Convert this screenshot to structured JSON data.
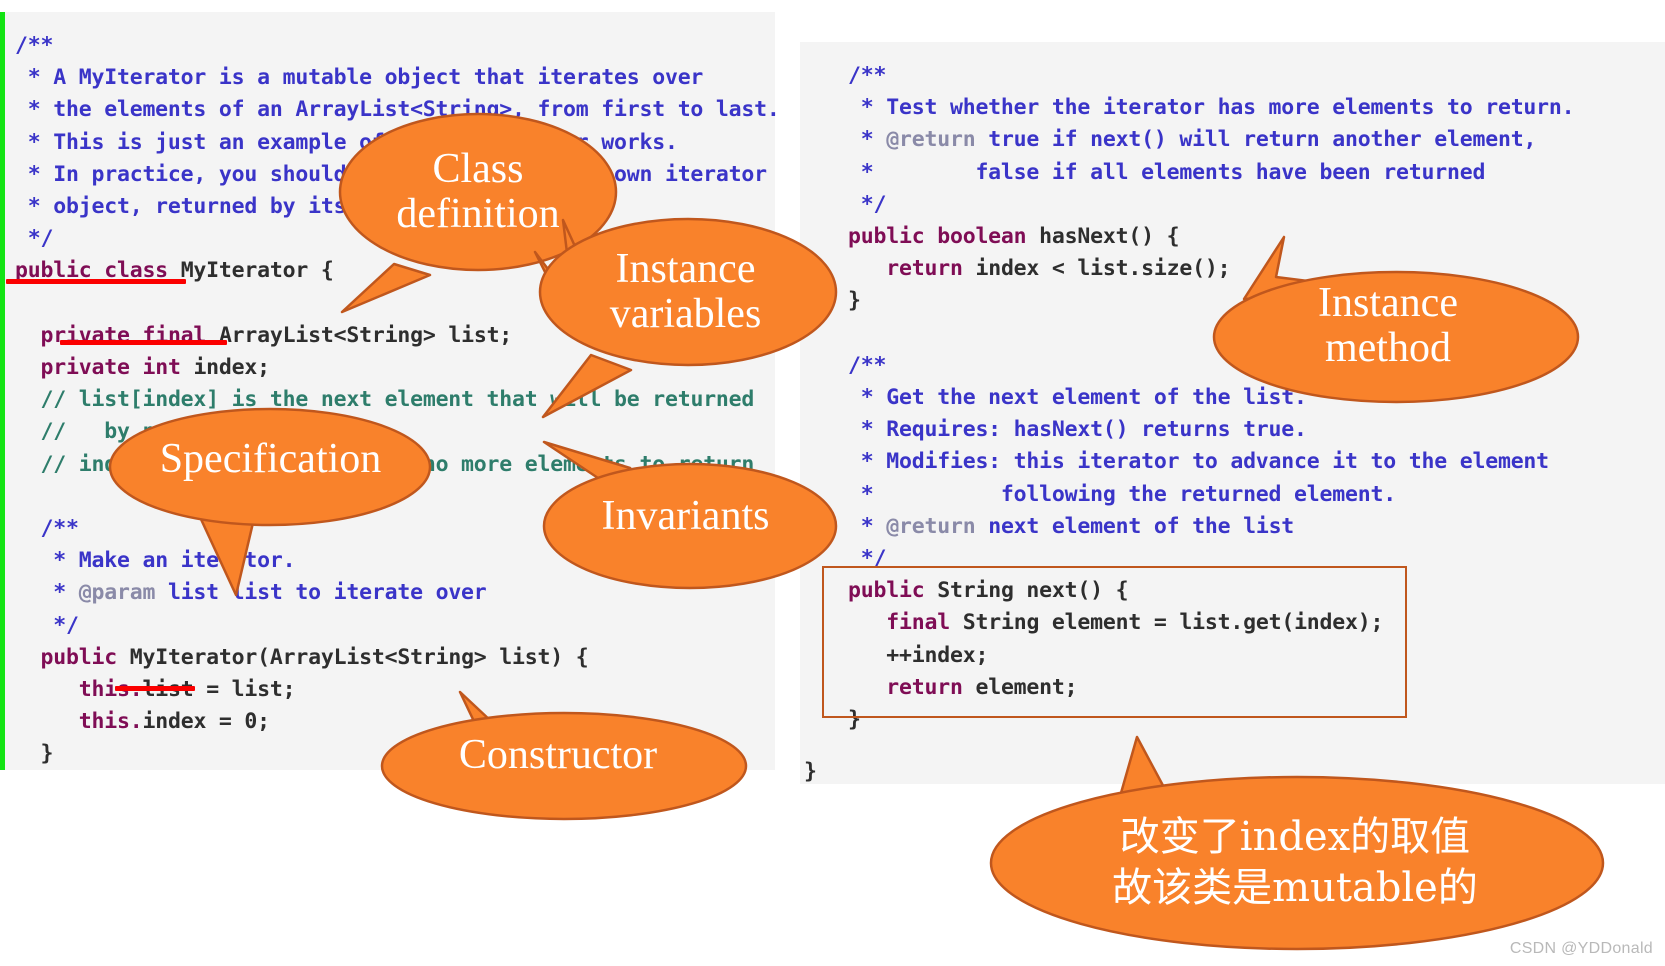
{
  "slide": {
    "watermark": "CSDN @YDDonald",
    "accent_orange": "#f9822b",
    "accent_orange_border": "#c0571d",
    "code_bg": "#f4f4f4",
    "green_bar": "#13e413",
    "underline_red": "#fb0000"
  },
  "left_panel": {
    "name": "MyIterator class definition code block",
    "lines": [
      "/**",
      " * A MyIterator is a mutable object that iterates over",
      " * the elements of an ArrayList<String>, from first to last.",
      " * This is just an example of how an iterator works.",
      " * In practice, you should use the ArrayList's own iterator",
      " * object, returned by its iterator() method.",
      " */",
      "public class MyIterator {",
      "",
      "    private final ArrayList<String> list;",
      "    private int index;",
      "    // list[index] is the next element that will be returned",
      "    //   by next()",
      "    // index == list.size() means no more elements to return",
      "",
      "    /**",
      "     * Make an iterator.",
      "     * @param list list to iterate over",
      "     */",
      "    public MyIterator(ArrayList<String> list) {",
      "        this.list = list;",
      "        this.index = 0;",
      "    }"
    ]
  },
  "right_panel": {
    "name": "hasNext and next method code block",
    "lines": [
      "    /**",
      "     * Test whether the iterator has more elements to return.",
      "     * @return true if next() will return another element,",
      "     *         false if all elements have been returned",
      "     */",
      "    public boolean hasNext() {",
      "        return index < list.size();",
      "    }",
      "",
      "    /**",
      "     * Get the next element of the list.",
      "     * Requires: hasNext() returns true.",
      "     * Modifies: this iterator to advance it to the element",
      "     *           following the returned element.",
      "     * @return next element of the list",
      "     */",
      "    public String next() {",
      "        final String element = list.get(index);",
      "        ++index;",
      "        return element;",
      "    }",
      "}"
    ]
  },
  "callouts": {
    "class_definition": "Class\ndefinition",
    "instance_variables": "Instance\nvariables",
    "specification": "Specification",
    "invariants": "Invariants",
    "constructor": "Constructor",
    "instance_method": "Instance\nmethod",
    "mutable_note": "改变了index的取值\n故该类是mutable的"
  },
  "highlights": {
    "underline_public_class": "public class",
    "underline_private_final": "private final",
    "underline_this_list": "this.",
    "box_label": "next() method body box"
  }
}
